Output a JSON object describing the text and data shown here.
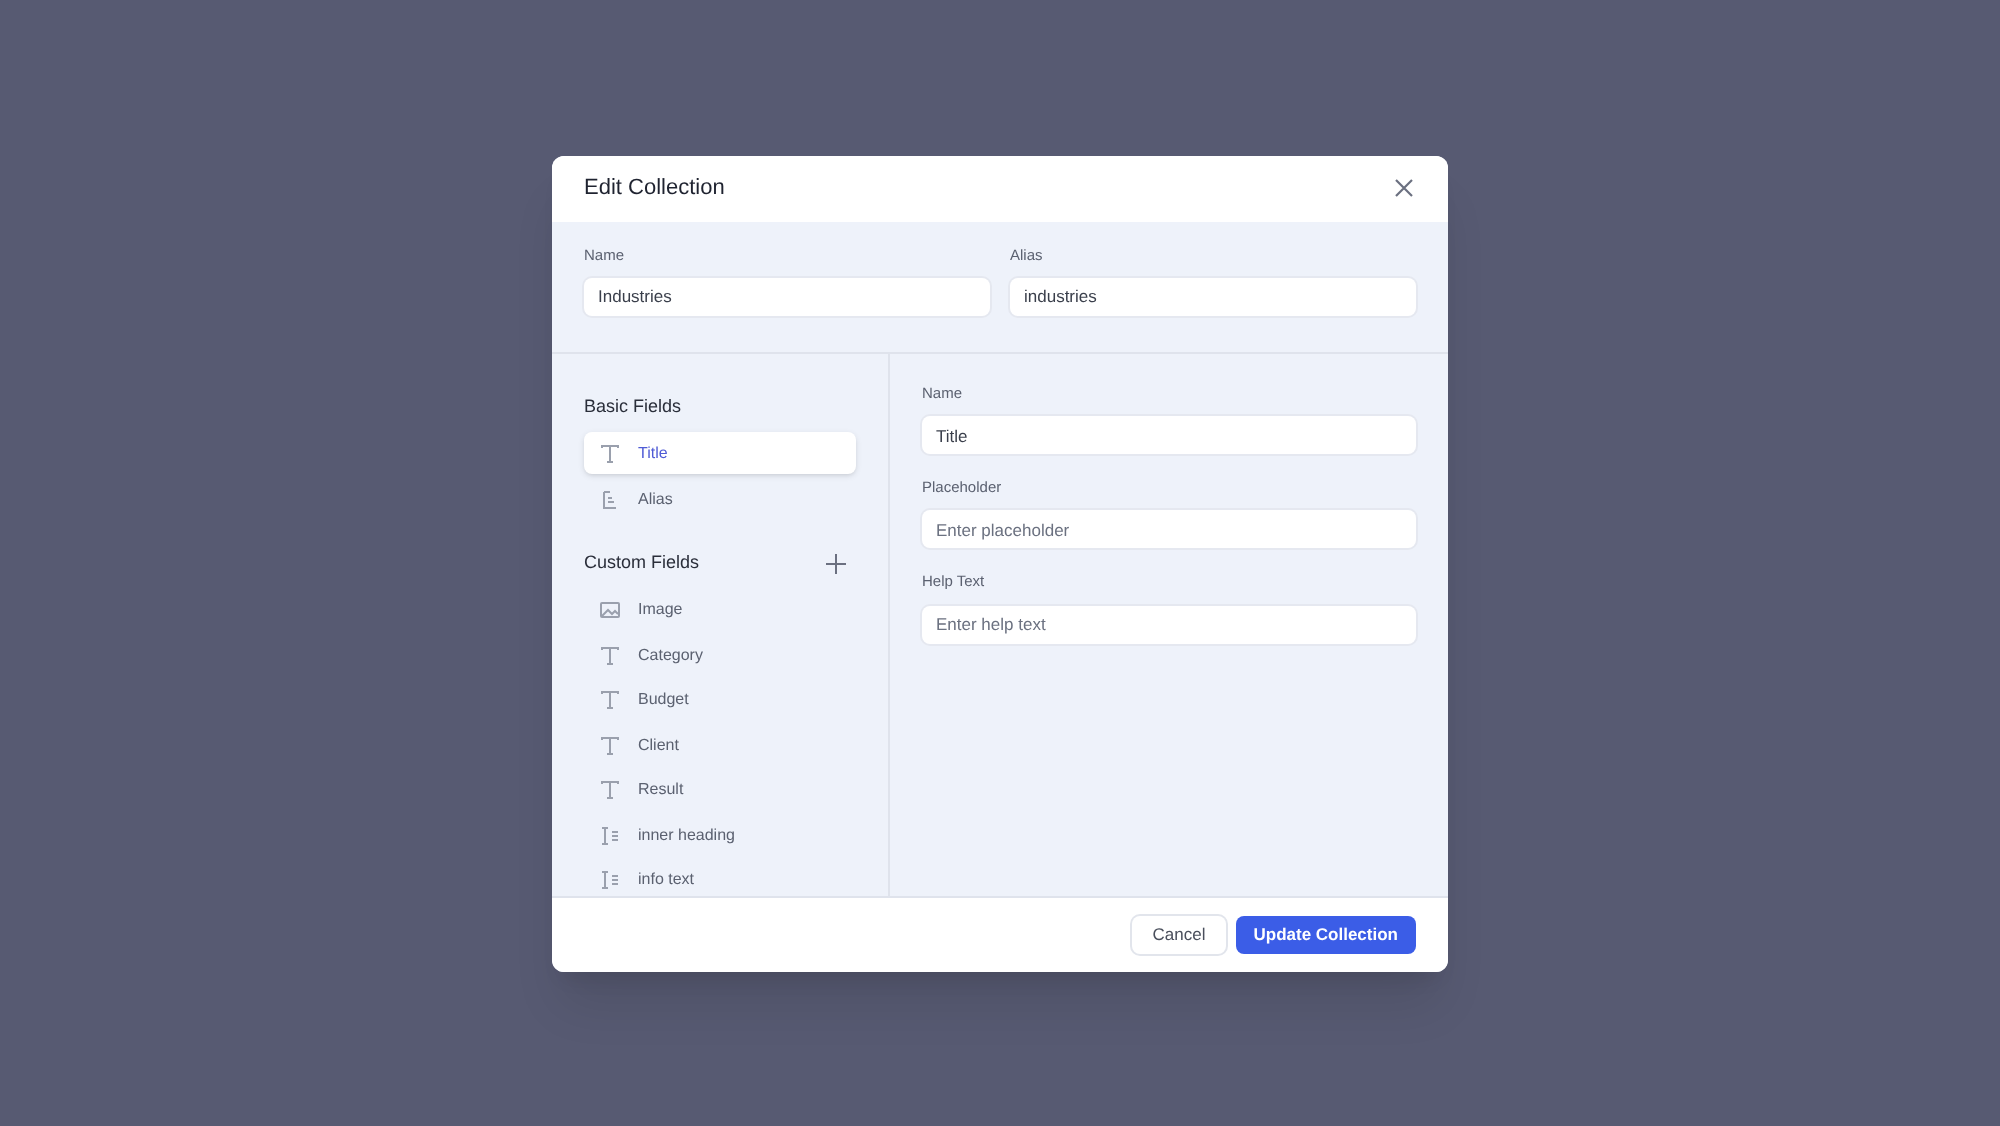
{
  "dialog": {
    "title": "Edit Collection"
  },
  "collection": [
    {
      "label": "Name",
      "value": "Industries"
    },
    {
      "label": "Alias",
      "value": "industries"
    }
  ],
  "basic_fields": {
    "title": "Basic Fields",
    "items": [
      {
        "label": "Title",
        "kind": "text",
        "selected": true
      },
      {
        "label": "Alias",
        "kind": "alias",
        "selected": false
      }
    ]
  },
  "custom_fields": {
    "title": "Custom Fields",
    "items": [
      {
        "label": "Image",
        "kind": "image",
        "selected": false
      },
      {
        "label": "Category",
        "kind": "text",
        "selected": false
      },
      {
        "label": "Budget",
        "kind": "text",
        "selected": false
      },
      {
        "label": "Client",
        "kind": "text",
        "selected": false
      },
      {
        "label": "Result",
        "kind": "text",
        "selected": false
      },
      {
        "label": "inner heading",
        "kind": "richtext",
        "selected": false
      },
      {
        "label": "info text",
        "kind": "richtext",
        "selected": false
      }
    ]
  },
  "field_settings": [
    {
      "label": "Name",
      "value": "Title"
    },
    {
      "label": "Placeholder",
      "placeholder": "Enter placeholder"
    },
    {
      "label": "Help Text",
      "placeholder": "Enter help text"
    }
  ],
  "buttons": {
    "cancel": "Cancel",
    "submit": "Update Collection"
  }
}
